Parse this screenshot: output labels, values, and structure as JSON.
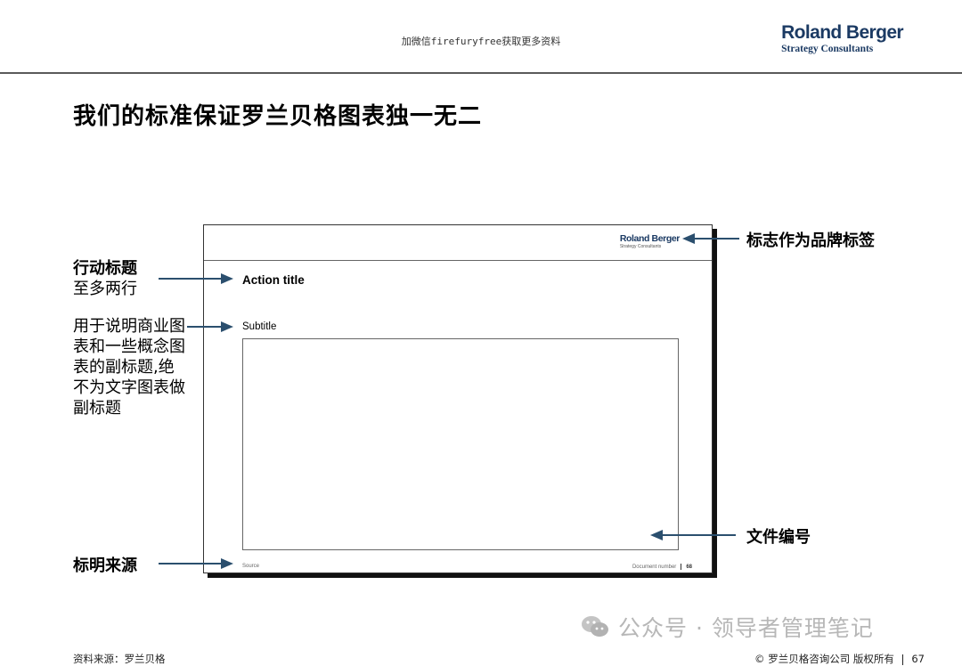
{
  "header": {
    "note": "加微信firefuryfree获取更多资料",
    "logo": {
      "brand": "Roland Berger",
      "tagline": "Strategy Consultants",
      "color": "#1b3a63"
    }
  },
  "title": "我们的标准保证罗兰贝格图表独一无二",
  "mini_slide": {
    "logo_brand": "Roland Berger",
    "logo_tagline": "Strategy Consultants",
    "action_title": "Action title",
    "subtitle": "Subtitle",
    "source": "Source",
    "document_number_label": "Document number",
    "page_number": "68"
  },
  "callouts": {
    "action": {
      "line1": "行动标题",
      "line2": "至多两行"
    },
    "subtitle": "用于说明商业图表和一些概念图表的副标题,绝不为文字图表做副标题",
    "source": "标明来源",
    "logo": "标志作为品牌标签",
    "doc_number": "文件编号",
    "arrow_color": "#2b4f6e"
  },
  "watermark": {
    "text": "公众号 · 领导者管理笔记",
    "icon": "wechat-icon"
  },
  "footer": {
    "source": "资料来源：罗兰贝格",
    "copyright": "© 罗兰贝格咨询公司 版权所有",
    "page": "67"
  }
}
